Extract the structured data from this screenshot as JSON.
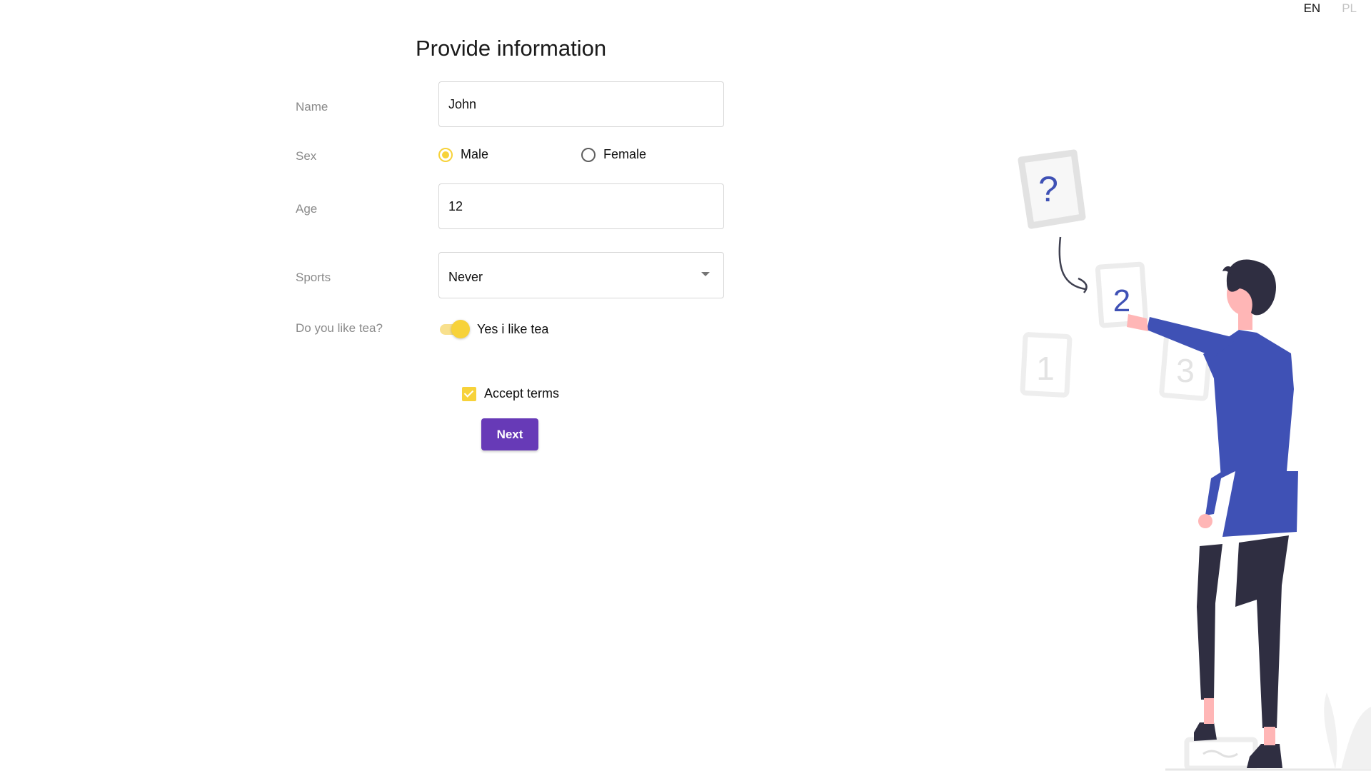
{
  "language": {
    "options": [
      {
        "code": "EN",
        "active": true
      },
      {
        "code": "PL",
        "active": false
      }
    ]
  },
  "form": {
    "title": "Provide information",
    "name": {
      "label": "Name",
      "value": "John"
    },
    "sex": {
      "label": "Sex",
      "options": [
        {
          "label": "Male",
          "checked": true
        },
        {
          "label": "Female",
          "checked": false
        }
      ]
    },
    "age": {
      "label": "Age",
      "value": "12"
    },
    "sports": {
      "label": "Sports",
      "selected": "Never"
    },
    "tea": {
      "label": "Do you like tea?",
      "toggle_label": "Yes i like tea",
      "on": true
    },
    "terms": {
      "label": "Accept terms",
      "checked": true
    },
    "next_label": "Next"
  },
  "illustration": {
    "cards": [
      "?",
      "2",
      "1",
      "3"
    ]
  },
  "colors": {
    "accent_yellow": "#f7d23a",
    "button_purple": "#673ab7",
    "shirt_blue": "#3f51b5",
    "pants_dark": "#2f2e41",
    "skin": "#ffb6b6"
  }
}
